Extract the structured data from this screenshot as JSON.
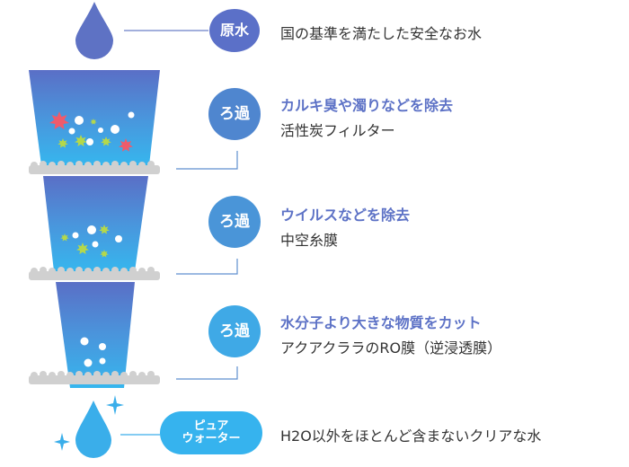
{
  "source": {
    "badge": "原水",
    "description": "国の基準を満たした安全なお水"
  },
  "stages": [
    {
      "badge": "ろ過",
      "target": "カルキ臭や濁りなどを除去",
      "filter": "活性炭フィルター"
    },
    {
      "badge": "ろ過",
      "target": "ウイルスなどを除去",
      "filter": "中空糸膜"
    },
    {
      "badge": "ろ過",
      "target": "水分子より大きな物質をカット",
      "filter": "アクアクララのRO膜（逆浸透膜）"
    }
  ],
  "result": {
    "badge_line1": "ピュア",
    "badge_line2": "ウォーター",
    "description": "H2O以外をほとんど含まないクリアな水"
  },
  "colors": {
    "source_drop": "#5e72c4",
    "funnel_top": "#5a6fc6",
    "funnel_bottom": "#36b6ee",
    "result_drop": "#3aaeea",
    "sparkle": "#3aaeea",
    "filter_layer": "#d0d0d0",
    "connector_line": "#5f8fcf",
    "contaminant_red": "#ef5b6b",
    "contaminant_green": "#b5d84a",
    "particle": "#ffffff"
  }
}
